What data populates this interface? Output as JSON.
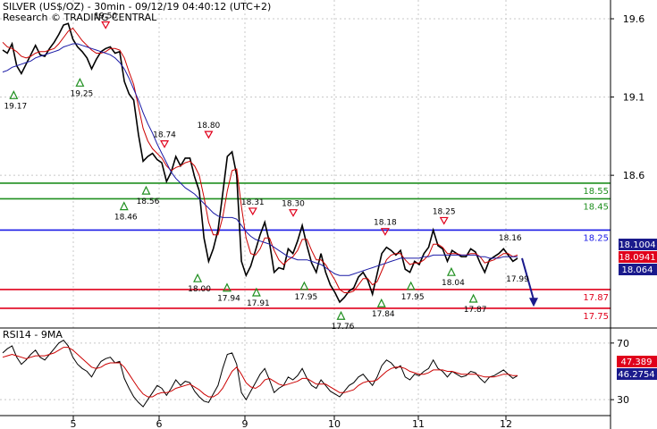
{
  "header": {
    "title": "SILVER (US$/OZ) - 30min - 09/12/19 04:40:12 (UTC+2)",
    "source": "Research © TRADING CENTRAL"
  },
  "colors": {
    "price": "#000000",
    "ma_fast": "#cc0000",
    "ma_slow": "#1a1aa6",
    "support": "#e0001b",
    "resistance": "#1f8f1f",
    "pivot": "#1a1ae6",
    "arrow": "#1a1a8c",
    "current_price_box": "#1a1a8c",
    "red_price_box": "#e0001b",
    "grid": "#c8c8c8"
  },
  "chart_data": [
    {
      "type": "line",
      "panel": "price",
      "ylim": [
        17.63,
        19.72
      ],
      "y_ticks": [
        19.6,
        19.1,
        18.6
      ],
      "x_ticks": [
        "5",
        "6",
        "9",
        "10",
        "11",
        "12"
      ],
      "horizontal_levels": [
        {
          "value": 18.55,
          "label": "18.55",
          "color": "#1f8f1f"
        },
        {
          "value": 18.45,
          "label": "18.45",
          "color": "#1f8f1f"
        },
        {
          "value": 18.25,
          "label": "18.25",
          "color": "#1a1ae6"
        },
        {
          "value": 17.87,
          "label": "17.87",
          "color": "#e0001b"
        },
        {
          "value": 17.75,
          "label": "17.75",
          "color": "#e0001b"
        }
      ],
      "price_boxes": [
        {
          "label": "18.1004",
          "color": "#1a1a8c",
          "value": 18.1004
        },
        {
          "label": "18.0941",
          "color": "#e0001b",
          "value": 18.0941
        },
        {
          "label": "18.064",
          "color": "#1a1a8c",
          "value": 18.064
        }
      ],
      "series": [
        {
          "values": [
            19.4,
            19.38,
            19.44,
            19.3,
            19.25,
            19.31,
            19.37,
            19.43,
            19.37,
            19.36,
            19.41,
            19.45,
            19.5,
            19.56,
            19.57,
            19.47,
            19.42,
            19.39,
            19.35,
            19.28,
            19.34,
            19.39,
            19.41,
            19.42,
            19.38,
            19.39,
            19.2,
            19.12,
            19.08,
            18.86,
            18.69,
            18.72,
            18.74,
            18.7,
            18.68,
            18.56,
            18.62,
            18.72,
            18.66,
            18.71,
            18.71,
            18.59,
            18.5,
            18.2,
            18.05,
            18.13,
            18.25,
            18.48,
            18.72,
            18.75,
            18.6,
            18.05,
            17.96,
            18.02,
            18.12,
            18.22,
            18.3,
            18.17,
            17.98,
            18.01,
            18.0,
            18.13,
            18.1,
            18.18,
            18.28,
            18.15,
            18.04,
            17.98,
            18.1,
            17.98,
            17.9,
            17.85,
            17.79,
            17.82,
            17.86,
            17.88,
            17.95,
            17.98,
            17.93,
            17.84,
            17.97,
            18.1,
            18.14,
            18.12,
            18.09,
            18.12,
            18.0,
            17.98,
            18.05,
            18.03,
            18.1,
            18.14,
            18.25,
            18.15,
            18.13,
            18.05,
            18.12,
            18.1,
            18.08,
            18.08,
            18.13,
            18.11,
            18.04,
            17.98,
            18.06,
            18.08,
            18.1,
            18.13,
            18.09,
            18.05,
            18.07
          ],
          "color": "#000000"
        },
        {
          "values": [
            19.45,
            19.42,
            19.41,
            19.39,
            19.36,
            19.35,
            19.36,
            19.38,
            19.39,
            19.39,
            19.4,
            19.41,
            19.44,
            19.48,
            19.52,
            19.54,
            19.5,
            19.46,
            19.43,
            19.4,
            19.38,
            19.38,
            19.39,
            19.41,
            19.41,
            19.4,
            19.35,
            19.26,
            19.18,
            19.04,
            18.9,
            18.82,
            18.77,
            18.74,
            18.71,
            18.66,
            18.63,
            18.65,
            18.66,
            18.68,
            18.69,
            18.66,
            18.6,
            18.46,
            18.3,
            18.22,
            18.22,
            18.33,
            18.5,
            18.63,
            18.64,
            18.4,
            18.2,
            18.1,
            18.09,
            18.13,
            18.2,
            18.2,
            18.12,
            18.06,
            18.03,
            18.06,
            18.08,
            18.12,
            18.19,
            18.19,
            18.12,
            18.06,
            18.06,
            18.03,
            17.98,
            17.93,
            17.87,
            17.85,
            17.85,
            17.86,
            17.9,
            17.94,
            17.94,
            17.9,
            17.92,
            17.99,
            18.06,
            18.09,
            18.1,
            18.1,
            18.06,
            18.03,
            18.04,
            18.04,
            18.06,
            18.09,
            18.16,
            18.16,
            18.14,
            18.1,
            18.1,
            18.1,
            18.09,
            18.09,
            18.1,
            18.1,
            18.08,
            18.04,
            18.05,
            18.06,
            18.08,
            18.1,
            18.1,
            18.08,
            18.09
          ],
          "color": "#cc0000"
        },
        {
          "values": [
            19.26,
            19.27,
            19.29,
            19.3,
            19.31,
            19.32,
            19.33,
            19.35,
            19.36,
            19.37,
            19.38,
            19.39,
            19.4,
            19.42,
            19.43,
            19.44,
            19.44,
            19.43,
            19.42,
            19.41,
            19.4,
            19.39,
            19.38,
            19.37,
            19.35,
            19.32,
            19.28,
            19.22,
            19.15,
            19.08,
            19.0,
            18.93,
            18.87,
            18.8,
            18.74,
            18.68,
            18.62,
            18.58,
            18.55,
            18.52,
            18.5,
            18.48,
            18.45,
            18.42,
            18.39,
            18.36,
            18.34,
            18.33,
            18.33,
            18.33,
            18.32,
            18.28,
            18.24,
            18.21,
            18.19,
            18.18,
            18.17,
            18.16,
            18.14,
            18.12,
            18.1,
            18.08,
            18.07,
            18.06,
            18.06,
            18.06,
            18.05,
            18.04,
            18.03,
            18.01,
            17.99,
            17.97,
            17.96,
            17.96,
            17.96,
            17.97,
            17.98,
            17.99,
            18.0,
            18.01,
            18.02,
            18.03,
            18.04,
            18.05,
            18.06,
            18.07,
            18.07,
            18.07,
            18.07,
            18.07,
            18.08,
            18.08,
            18.09,
            18.09,
            18.09,
            18.09,
            18.09,
            18.09,
            18.09,
            18.09,
            18.09,
            18.09,
            18.08,
            18.08,
            18.07,
            18.07,
            18.07,
            18.08,
            18.08,
            18.08,
            18.08
          ],
          "color": "#1a1aa6"
        }
      ],
      "annotations": [
        {
          "text": "19.17",
          "kind": "low",
          "index": 3,
          "value": 19.17
        },
        {
          "text": "19.25",
          "kind": "low",
          "index": 21,
          "value": 19.25
        },
        {
          "text": "19.50",
          "kind": "high",
          "index": 28,
          "value": 19.5
        },
        {
          "text": "18.46",
          "kind": "low",
          "index": 33,
          "value": 18.46
        },
        {
          "text": "18.56",
          "kind": "low",
          "index": 39,
          "value": 18.56
        },
        {
          "text": "18.74",
          "kind": "high",
          "index": 44,
          "value": 18.74
        },
        {
          "text": "18.80",
          "kind": "high",
          "index": 56,
          "value": 18.8
        },
        {
          "text": "18.00",
          "kind": "low",
          "index": 53,
          "value": 18.0
        },
        {
          "text": "17.94",
          "kind": "low",
          "index": 61,
          "value": 17.94
        },
        {
          "text": "18.31",
          "kind": "high",
          "index": 68,
          "value": 18.31
        },
        {
          "text": "17.91",
          "kind": "low",
          "index": 69,
          "value": 17.91
        },
        {
          "text": "18.30",
          "kind": "high",
          "index": 79,
          "value": 18.3
        },
        {
          "text": "17.95",
          "kind": "low",
          "index": 82,
          "value": 17.95
        },
        {
          "text": "17.76",
          "kind": "low",
          "index": 92,
          "value": 17.76
        },
        {
          "text": "17.84",
          "kind": "low",
          "index": 103,
          "value": 17.84
        },
        {
          "text": "18.18",
          "kind": "high",
          "index": 104,
          "value": 18.18
        },
        {
          "text": "17.95",
          "kind": "low",
          "index": 111,
          "value": 17.95
        },
        {
          "text": "18.25",
          "kind": "high",
          "index": 120,
          "value": 18.25
        },
        {
          "text": "18.04",
          "kind": "low",
          "index": 122,
          "value": 18.04
        },
        {
          "text": "17.87",
          "kind": "low",
          "index": 128,
          "value": 17.87
        },
        {
          "text": "18.16",
          "kind": "label",
          "index": 138,
          "value": 18.16
        },
        {
          "text": "17.99",
          "kind": "label",
          "index": 140,
          "value": 17.99
        }
      ]
    },
    {
      "type": "line",
      "panel": "rsi",
      "title": "RSI14 - 9MA",
      "ylim": [
        20,
        80
      ],
      "y_ticks": [
        70,
        30
      ],
      "price_boxes": [
        {
          "label": "47.389",
          "color": "#e0001b",
          "value": 47.389
        },
        {
          "label": "46.2754",
          "color": "#1a1a8c",
          "value": 46.2754
        }
      ],
      "series": [
        {
          "values": [
            63,
            66,
            68,
            60,
            55,
            58,
            62,
            65,
            60,
            58,
            62,
            66,
            70,
            72,
            68,
            60,
            55,
            52,
            50,
            46,
            52,
            57,
            59,
            60,
            56,
            57,
            45,
            38,
            32,
            28,
            25,
            30,
            35,
            40,
            38,
            33,
            38,
            44,
            40,
            43,
            42,
            36,
            32,
            29,
            28,
            34,
            40,
            52,
            62,
            63,
            55,
            35,
            30,
            36,
            42,
            48,
            52,
            44,
            35,
            38,
            40,
            46,
            44,
            47,
            52,
            45,
            40,
            38,
            44,
            40,
            36,
            34,
            32,
            36,
            40,
            42,
            46,
            48,
            44,
            40,
            46,
            54,
            58,
            56,
            52,
            54,
            46,
            44,
            48,
            47,
            50,
            52,
            58,
            52,
            50,
            46,
            50,
            48,
            46,
            47,
            50,
            49,
            45,
            42,
            46,
            47,
            49,
            51,
            48,
            45,
            47
          ],
          "color": "#000000"
        },
        {
          "values": [
            60,
            61,
            62,
            61,
            60,
            59,
            60,
            61,
            61,
            61,
            62,
            63,
            65,
            67,
            67,
            65,
            62,
            59,
            56,
            53,
            52,
            53,
            55,
            56,
            56,
            56,
            53,
            48,
            43,
            38,
            34,
            32,
            32,
            34,
            35,
            35,
            36,
            38,
            39,
            40,
            41,
            39,
            37,
            34,
            32,
            32,
            34,
            38,
            44,
            50,
            53,
            48,
            42,
            39,
            38,
            40,
            44,
            45,
            43,
            41,
            40,
            41,
            42,
            43,
            45,
            45,
            43,
            41,
            41,
            41,
            39,
            37,
            35,
            35,
            36,
            37,
            40,
            42,
            43,
            43,
            44,
            47,
            50,
            52,
            53,
            53,
            52,
            50,
            49,
            48,
            48,
            49,
            51,
            51,
            51,
            50,
            50,
            49,
            48,
            48,
            48,
            48,
            47,
            46,
            46,
            46,
            47,
            48,
            48,
            47,
            47
          ],
          "color": "#cc0000"
        }
      ]
    }
  ]
}
